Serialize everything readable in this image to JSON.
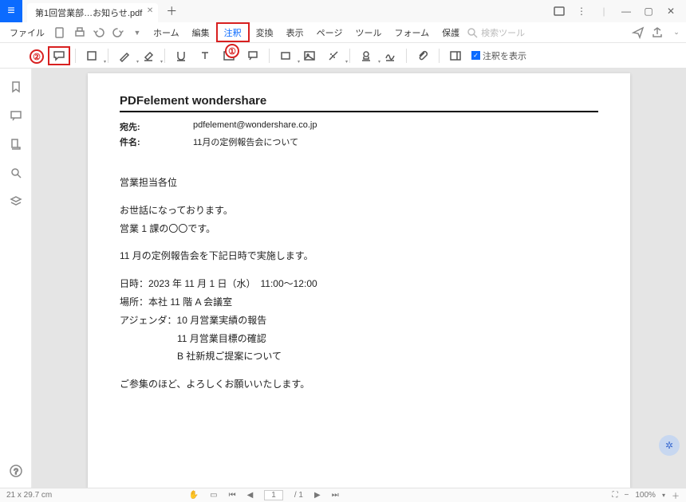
{
  "titlebar": {
    "tab_name": "第1回営業部…お知らせ.pdf"
  },
  "menu": {
    "file": "ファイル",
    "home": "ホーム",
    "edit": "編集",
    "annotate": "注釈",
    "convert": "変換",
    "view": "表示",
    "page": "ページ",
    "tool": "ツール",
    "form": "フォーム",
    "protect": "保護",
    "search_ph": "検索ツール"
  },
  "toolbar": {
    "show_annotations": "注釈を表示"
  },
  "badges": {
    "one": "①",
    "two": "②"
  },
  "doc": {
    "title": "PDFelement wondershare",
    "to_label": "宛先:",
    "to_value": "pdfelement@wondershare.co.jp",
    "subject_label": "件名:",
    "subject_value": "11月の定例報告会について",
    "greeting": "営業担当各位",
    "l1": "お世話になっております。",
    "l2": "営業 1 課の〇〇です。",
    "l3": "11 月の定例報告会を下記日時で実施します。",
    "l4": "日時：2023 年 11 月 1 日（水）　11:00〜12:00",
    "l5": "場所：本社 11 階 A 会議室",
    "l6": "アジェンダ：10 月営業実績の報告",
    "l7": "11 月営業目標の確認",
    "l8": "B 社新規ご提案について",
    "l9": "ご参集のほど、よろしくお願いいたします。"
  },
  "status": {
    "dim": "21 x 29.7 cm",
    "page_current": "1",
    "page_total": "/ 1",
    "zoom": "100%"
  }
}
